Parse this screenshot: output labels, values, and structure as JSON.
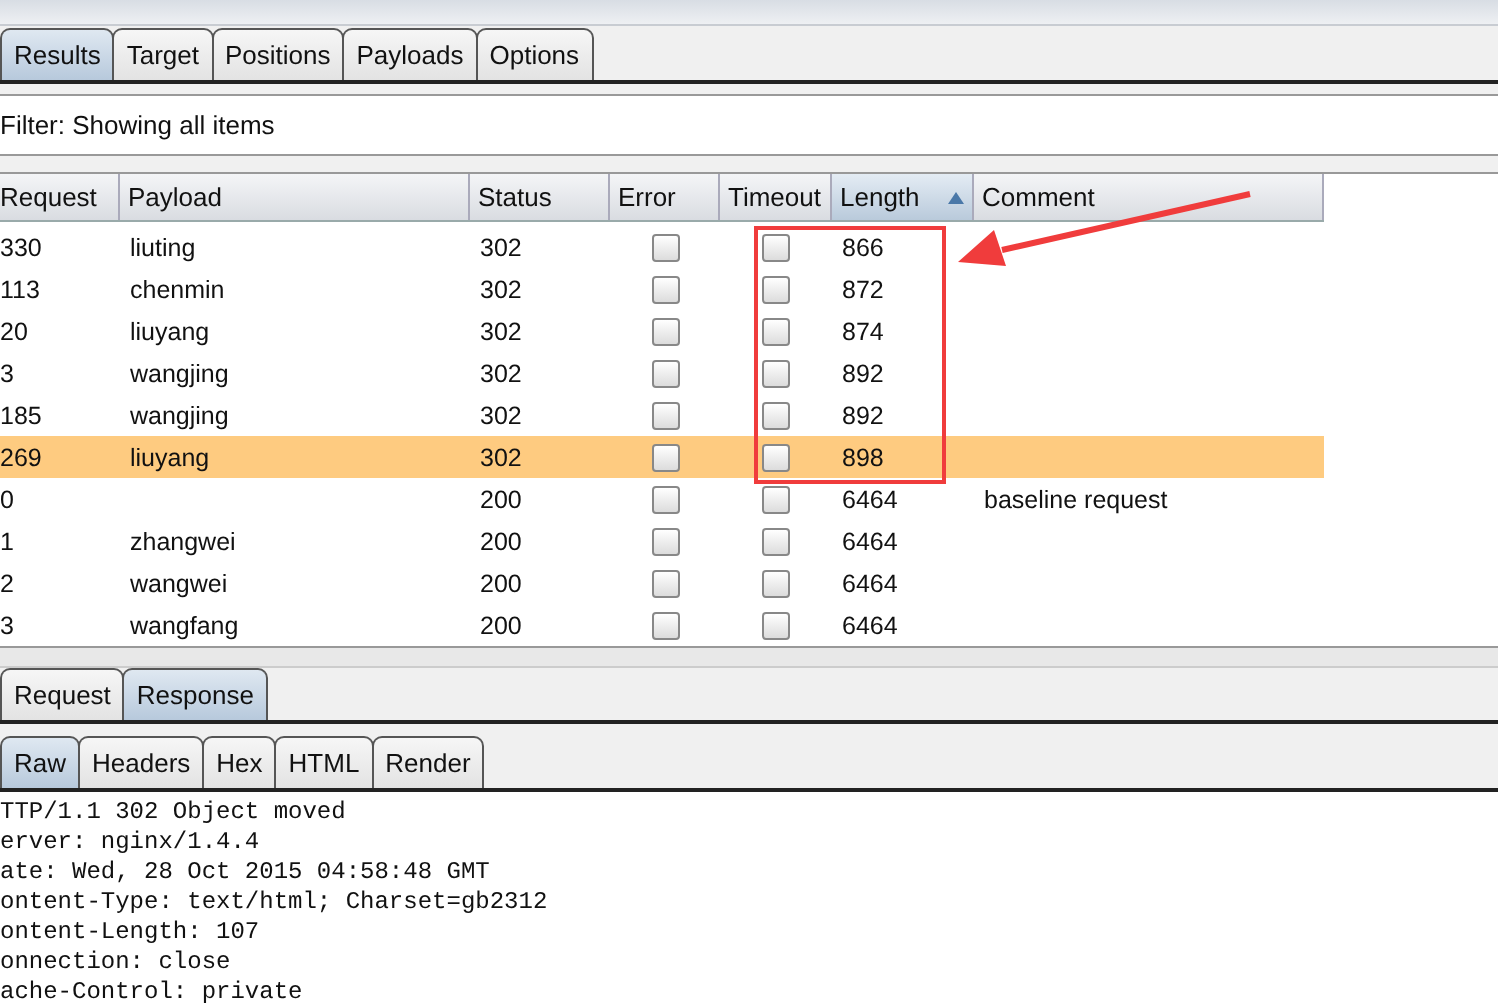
{
  "tabs": [
    {
      "label": "Results",
      "selected": true
    },
    {
      "label": "Target",
      "selected": false
    },
    {
      "label": "Positions",
      "selected": false
    },
    {
      "label": "Payloads",
      "selected": false
    },
    {
      "label": "Options",
      "selected": false
    }
  ],
  "filter": "Filter: Showing all items",
  "table": {
    "columns": [
      {
        "label": "Request",
        "sorted": false
      },
      {
        "label": "Payload",
        "sorted": false
      },
      {
        "label": "Status",
        "sorted": false
      },
      {
        "label": "Error",
        "sorted": false
      },
      {
        "label": "Timeout",
        "sorted": false
      },
      {
        "label": "Length",
        "sorted": true
      },
      {
        "label": "Comment",
        "sorted": false
      }
    ],
    "rows": [
      {
        "request": "330",
        "payload": "liuting",
        "status": "302",
        "error": false,
        "timeout": false,
        "length": "866",
        "comment": "",
        "selected": false
      },
      {
        "request": "113",
        "payload": "chenmin",
        "status": "302",
        "error": false,
        "timeout": false,
        "length": "872",
        "comment": "",
        "selected": false
      },
      {
        "request": "20",
        "payload": "liuyang",
        "status": "302",
        "error": false,
        "timeout": false,
        "length": "874",
        "comment": "",
        "selected": false
      },
      {
        "request": "3",
        "payload": "wangjing",
        "status": "302",
        "error": false,
        "timeout": false,
        "length": "892",
        "comment": "",
        "selected": false
      },
      {
        "request": "185",
        "payload": "wangjing",
        "status": "302",
        "error": false,
        "timeout": false,
        "length": "892",
        "comment": "",
        "selected": false
      },
      {
        "request": "269",
        "payload": "liuyang",
        "status": "302",
        "error": false,
        "timeout": false,
        "length": "898",
        "comment": "",
        "selected": true
      },
      {
        "request": "0",
        "payload": "",
        "status": "200",
        "error": false,
        "timeout": false,
        "length": "6464",
        "comment": "baseline request",
        "selected": false
      },
      {
        "request": "1",
        "payload": "zhangwei",
        "status": "200",
        "error": false,
        "timeout": false,
        "length": "6464",
        "comment": "",
        "selected": false
      },
      {
        "request": "2",
        "payload": "wangwei",
        "status": "200",
        "error": false,
        "timeout": false,
        "length": "6464",
        "comment": "",
        "selected": false
      },
      {
        "request": "3",
        "payload": "wangfang",
        "status": "200",
        "error": false,
        "timeout": false,
        "length": "6464",
        "comment": "",
        "selected": false
      }
    ]
  },
  "message_tabs": [
    {
      "label": "Request",
      "selected": false
    },
    {
      "label": "Response",
      "selected": true
    }
  ],
  "view_tabs": [
    {
      "label": "Raw",
      "selected": true
    },
    {
      "label": "Headers",
      "selected": false
    },
    {
      "label": "Hex",
      "selected": false
    },
    {
      "label": "HTML",
      "selected": false
    },
    {
      "label": "Render",
      "selected": false
    }
  ],
  "response_lines": [
    "TTP/1.1 302 Object moved",
    "erver: nginx/1.4.4",
    "ate: Wed, 28 Oct 2015 04:58:48 GMT",
    "ontent-Type: text/html; Charset=gb2312",
    "ontent-Length: 107",
    "onnection: close",
    "ache-Control: private"
  ]
}
